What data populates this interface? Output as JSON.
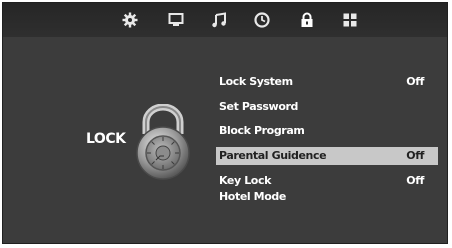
{
  "tabs": [
    {
      "icon": "gear-icon"
    },
    {
      "icon": "monitor-icon"
    },
    {
      "icon": "music-note-icon"
    },
    {
      "icon": "clock-icon"
    },
    {
      "icon": "lock-icon",
      "active": true
    },
    {
      "icon": "grid-icon"
    }
  ],
  "section": {
    "title": "LOCK"
  },
  "menu": {
    "items": [
      {
        "label": "Lock System",
        "value": "Off"
      },
      {
        "label": "Set Password",
        "value": ""
      },
      {
        "label": "Block Program",
        "value": ""
      },
      {
        "label": "Parental Guidence",
        "value": "Off",
        "selected": true
      },
      {
        "label": "Key Lock",
        "value": "Off"
      },
      {
        "label": "Hotel Mode",
        "value": ""
      }
    ]
  },
  "colors": {
    "background": "#3c3c3c",
    "highlight": "#c8c8c8",
    "text": "#ffffff"
  }
}
